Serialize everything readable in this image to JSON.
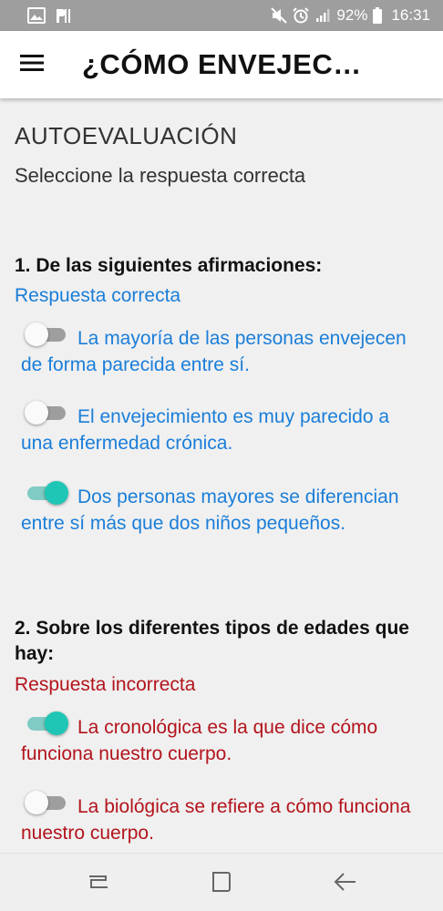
{
  "status_bar": {
    "battery_percent": "92%",
    "time": "16:31",
    "icons": [
      "image-icon",
      "p-notification-icon",
      "mute-icon",
      "alarm-icon",
      "signal-icon",
      "battery-icon"
    ]
  },
  "app_bar": {
    "title": "¿CÓMO ENVEJEC…"
  },
  "page": {
    "heading": "AUTOEVALUACIÓN",
    "subtitle": "Seleccione la respuesta correcta"
  },
  "questions": [
    {
      "text": "1. De las siguientes afirmaciones:",
      "result": "Respuesta correcta",
      "result_color": "#1a7ed9",
      "options": [
        {
          "text": "La mayoría de las personas envejecen de forma parecida entre sí.",
          "checked": false
        },
        {
          "text": "El envejecimiento es muy parecido a una enfermedad crónica.",
          "checked": false
        },
        {
          "text": "Dos personas mayores se diferencian entre sí más que dos niños pequeños.",
          "checked": true
        }
      ]
    },
    {
      "text": "2. Sobre los diferentes tipos de edades que hay:",
      "result": "Respuesta incorrecta",
      "result_color": "#b3141c",
      "options": [
        {
          "text": "La cronológica es la que dice cómo funciona nuestro cuerpo.",
          "checked": true
        },
        {
          "text": "La biológica se refiere a cómo funciona nuestro cuerpo.",
          "checked": false
        }
      ]
    }
  ],
  "colors": {
    "accent_teal": "#1fc6b6",
    "correct_blue": "#1a7ed9",
    "incorrect_red": "#b3141c"
  },
  "nav_bar": {
    "icons": [
      "recent-apps-icon",
      "home-icon",
      "back-icon"
    ]
  }
}
